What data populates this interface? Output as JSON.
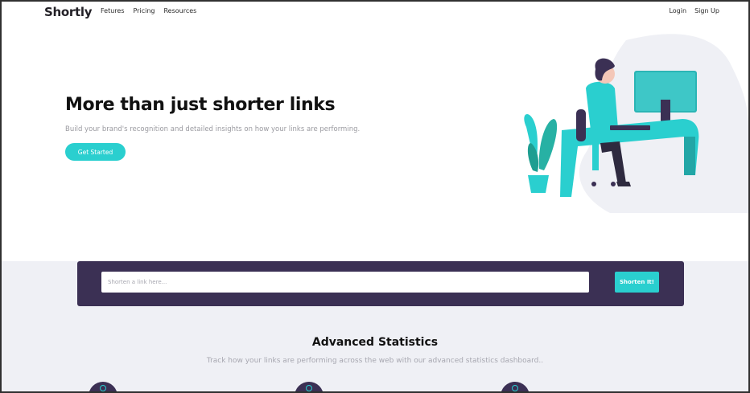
{
  "nav": {
    "logo": "Shortly",
    "links": [
      "Fetures",
      "Pricing",
      "Resources"
    ],
    "login": "Login",
    "signup": "Sign Up"
  },
  "hero": {
    "title": "More than just shorter links",
    "subtitle": "Build your brand's recognition and detailed insights on how your links are performing.",
    "cta": "Get Started"
  },
  "shorten": {
    "placeholder": "Shorten a link here...",
    "button": "Shorten It!"
  },
  "stats": {
    "title": "Advanced Statistics",
    "subtitle": "Track how your links are performing across the web with our advanced statistics dashboard.."
  },
  "colors": {
    "primary": "#2acfcf",
    "dark_violet": "#3b3054",
    "section_bg": "#eff0f5"
  }
}
